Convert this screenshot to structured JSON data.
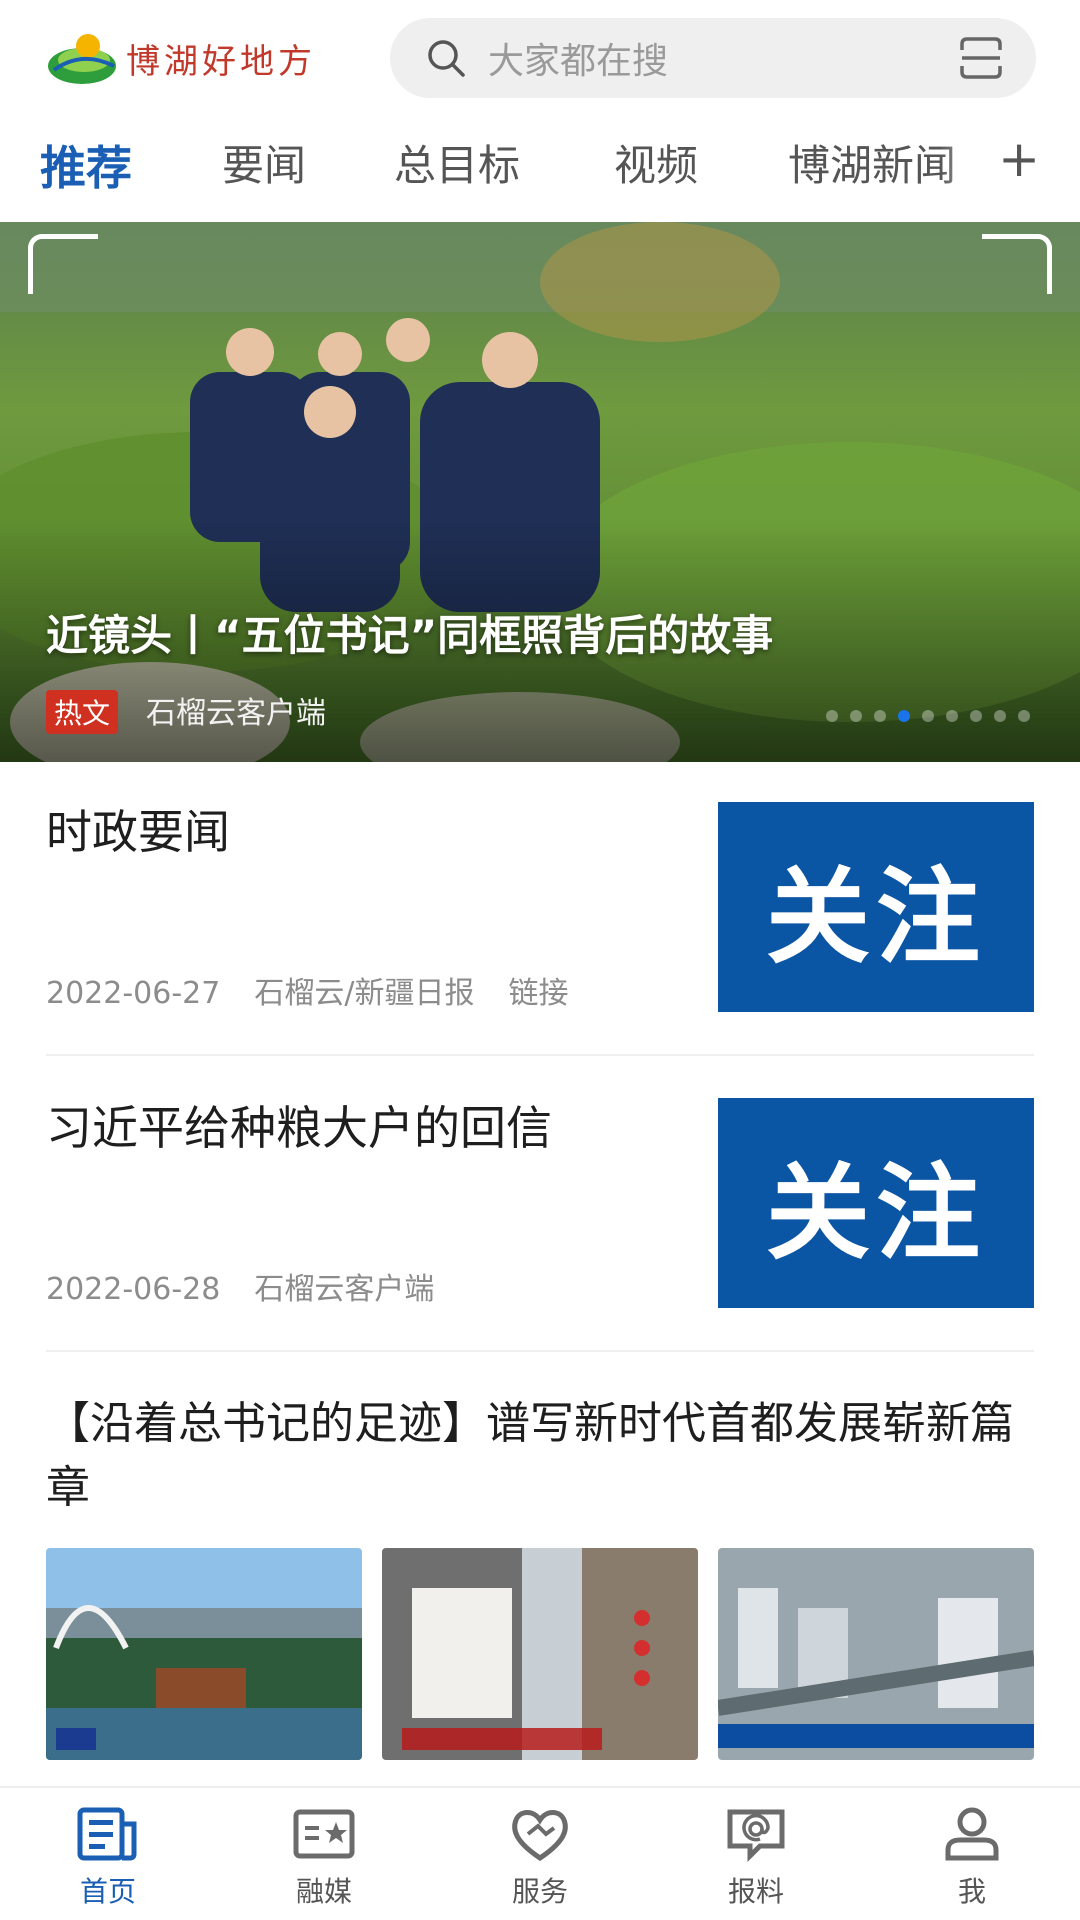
{
  "header": {
    "logo_text": "博湖好地方",
    "search_placeholder": "大家都在搜"
  },
  "tabs": [
    {
      "label": "推荐",
      "active": true
    },
    {
      "label": "要闻"
    },
    {
      "label": "总目标"
    },
    {
      "label": "视频"
    },
    {
      "label": "博湖新闻"
    }
  ],
  "banner": {
    "title": "近镜头丨“五位书记”同框照背后的故事",
    "tag": "热文",
    "source": "石榴云客户端",
    "dots_total": 9,
    "dots_active": 3
  },
  "news": [
    {
      "title": "时政要闻",
      "date": "2022-06-27",
      "source": "石榴云/新疆日报",
      "extra": "链接",
      "thumb_text": "关注"
    },
    {
      "title": "习近平给种粮大户的回信",
      "date": "2022-06-28",
      "source": "石榴云客户端",
      "thumb_text": "关注"
    },
    {
      "title": "【沿着总书记的足迹】谱写新时代首都发展崭新篇章"
    }
  ],
  "bottom_nav": [
    {
      "label": "首页",
      "icon": "news-icon",
      "active": true
    },
    {
      "label": "融媒",
      "icon": "media-icon"
    },
    {
      "label": "服务",
      "icon": "heart-icon"
    },
    {
      "label": "报料",
      "icon": "report-icon"
    },
    {
      "label": "我",
      "icon": "user-icon"
    }
  ],
  "colors": {
    "accent": "#1a5fb4",
    "tag_red": "#d0301f",
    "thumb_blue": "#0b56a4"
  }
}
